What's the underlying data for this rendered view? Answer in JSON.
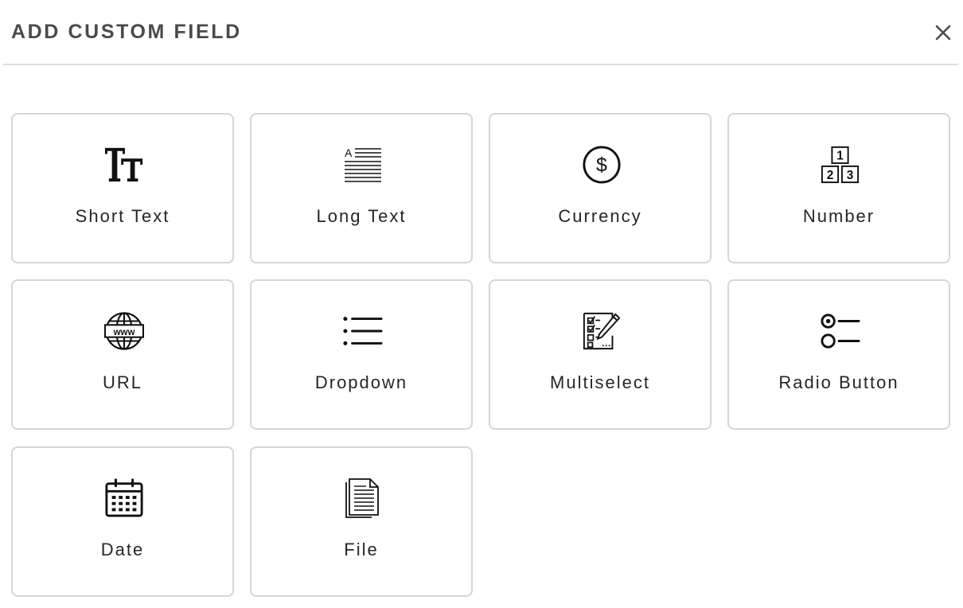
{
  "dialog": {
    "title": "ADD CUSTOM FIELD",
    "close_icon": "close-icon"
  },
  "fields": [
    {
      "label": "Short Text",
      "icon": "text-size-icon"
    },
    {
      "label": "Long Text",
      "icon": "paragraph-text-icon"
    },
    {
      "label": "Currency",
      "icon": "dollar-circle-icon"
    },
    {
      "label": "Number",
      "icon": "number-blocks-icon"
    },
    {
      "label": "URL",
      "icon": "globe-www-icon"
    },
    {
      "label": "Dropdown",
      "icon": "bulleted-list-icon"
    },
    {
      "label": "Multiselect",
      "icon": "checklist-pencil-icon"
    },
    {
      "label": "Radio Button",
      "icon": "radio-options-icon"
    },
    {
      "label": "Date",
      "icon": "calendar-icon"
    },
    {
      "label": "File",
      "icon": "document-icon"
    }
  ],
  "colors": {
    "title": "#4a4a4a",
    "card_border": "#d6d6d6",
    "divider": "#dedede",
    "label": "#262626"
  }
}
